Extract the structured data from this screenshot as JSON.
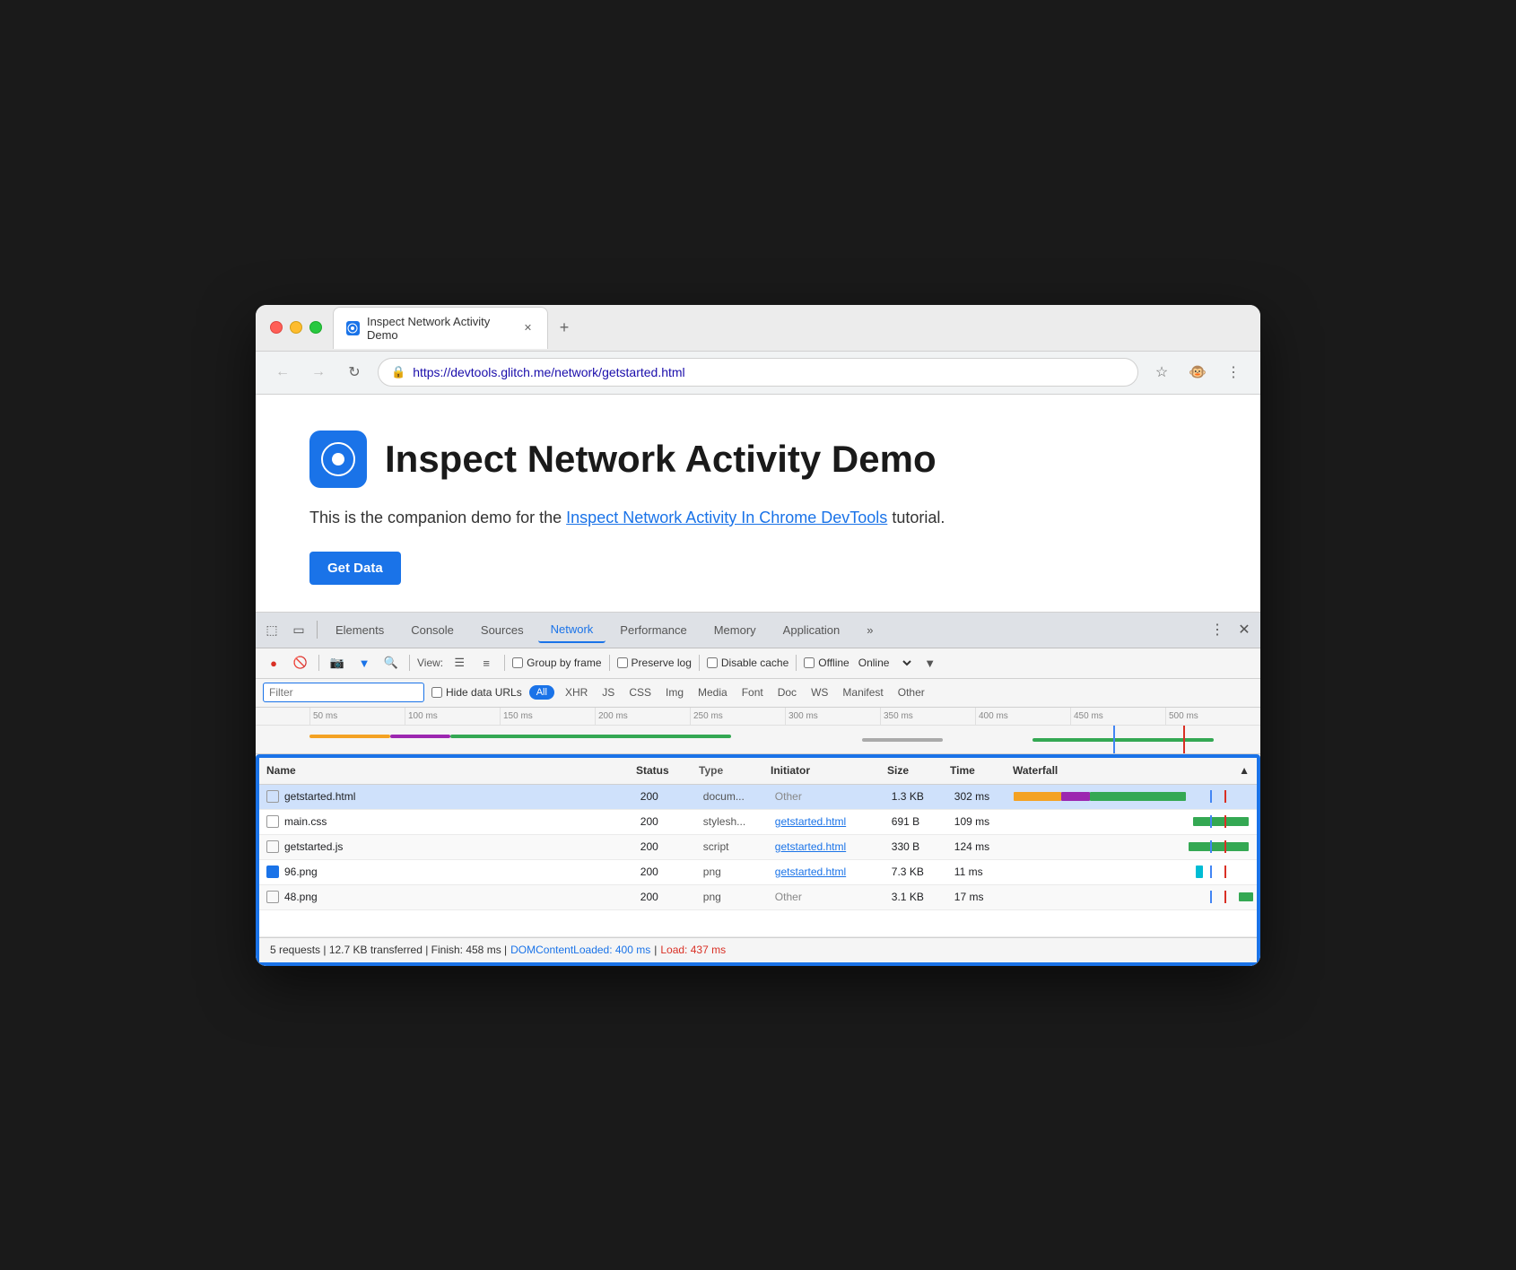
{
  "browser": {
    "tab": {
      "title": "Inspect Network Activity Demo",
      "favicon_label": "glitch-favicon"
    },
    "nav": {
      "back_label": "←",
      "forward_label": "→",
      "refresh_label": "↻",
      "url_protocol": "https://",
      "url_domain": "devtools.glitch.me",
      "url_path": "/network/getstarted.html",
      "full_url": "https://devtools.glitch.me/network/getstarted.html"
    },
    "new_tab_label": "+"
  },
  "page": {
    "title": "Inspect Network Activity Demo",
    "subtitle_text": "This is the companion demo for the",
    "subtitle_link": "Inspect Network Activity In Chrome DevTools",
    "subtitle_suffix": " tutorial.",
    "get_data_label": "Get Data"
  },
  "devtools": {
    "tabs": [
      "Elements",
      "Console",
      "Sources",
      "Network",
      "Performance",
      "Memory",
      "Application",
      "»"
    ],
    "active_tab": "Network",
    "toolbar": {
      "record_label": "●",
      "clear_label": "🚫",
      "camera_label": "📷",
      "filter_icon": "▼",
      "search_icon": "🔍",
      "view_label": "View:",
      "list_icon": "☰",
      "tree_icon": "≡",
      "group_by_frame": "Group by frame",
      "preserve_log": "Preserve log",
      "disable_cache": "Disable cache",
      "offline_label": "Offline",
      "online_label": "Online"
    },
    "filter": {
      "placeholder": "Filter",
      "hide_data_urls": "Hide data URLs",
      "all_chip": "All",
      "types": [
        "XHR",
        "JS",
        "CSS",
        "Img",
        "Media",
        "Font",
        "Doc",
        "WS",
        "Manifest",
        "Other"
      ]
    },
    "timeline": {
      "ticks": [
        "50 ms",
        "100 ms",
        "150 ms",
        "200 ms",
        "250 ms",
        "300 ms",
        "350 ms",
        "400 ms",
        "450 ms",
        "500 ms"
      ]
    },
    "table": {
      "headers": [
        "Name",
        "Status",
        "Type",
        "Initiator",
        "Size",
        "Time",
        "Waterfall"
      ],
      "rows": [
        {
          "name": "getstarted.html",
          "status": "200",
          "type": "docum...",
          "initiator": "Other",
          "initiator_link": false,
          "size": "1.3 KB",
          "time": "302 ms",
          "waterfall": [
            {
              "type": "orange",
              "left": "0%",
              "width": "20%"
            },
            {
              "type": "purple",
              "left": "20%",
              "width": "12%"
            },
            {
              "type": "green",
              "left": "32%",
              "width": "40%"
            }
          ]
        },
        {
          "name": "main.css",
          "status": "200",
          "type": "stylesh...",
          "initiator": "getstarted.html",
          "initiator_link": true,
          "size": "691 B",
          "time": "109 ms",
          "waterfall": [
            {
              "type": "green",
              "left": "75%",
              "width": "23%"
            }
          ]
        },
        {
          "name": "getstarted.js",
          "status": "200",
          "type": "script",
          "initiator": "getstarted.html",
          "initiator_link": true,
          "size": "330 B",
          "time": "124 ms",
          "waterfall": [
            {
              "type": "green",
              "left": "73%",
              "width": "25%"
            }
          ]
        },
        {
          "name": "96.png",
          "status": "200",
          "type": "png",
          "initiator": "getstarted.html",
          "initiator_link": true,
          "size": "7.3 KB",
          "time": "11 ms",
          "waterfall": [
            {
              "type": "teal",
              "left": "76%",
              "width": "3%"
            }
          ],
          "is_image": true
        },
        {
          "name": "48.png",
          "status": "200",
          "type": "png",
          "initiator": "Other",
          "initiator_link": false,
          "size": "3.1 KB",
          "time": "17 ms",
          "waterfall": [
            {
              "type": "green",
              "left": "95%",
              "width": "5%"
            }
          ]
        }
      ],
      "blue_line_pct": "82%",
      "red_line_pct": "88%"
    },
    "status_bar": {
      "text": "5 requests | 12.7 KB transferred | Finish: 458 ms |",
      "dom_content_label": "DOMContentLoaded: 400 ms",
      "separator": "|",
      "load_label": "Load: 437 ms"
    }
  }
}
